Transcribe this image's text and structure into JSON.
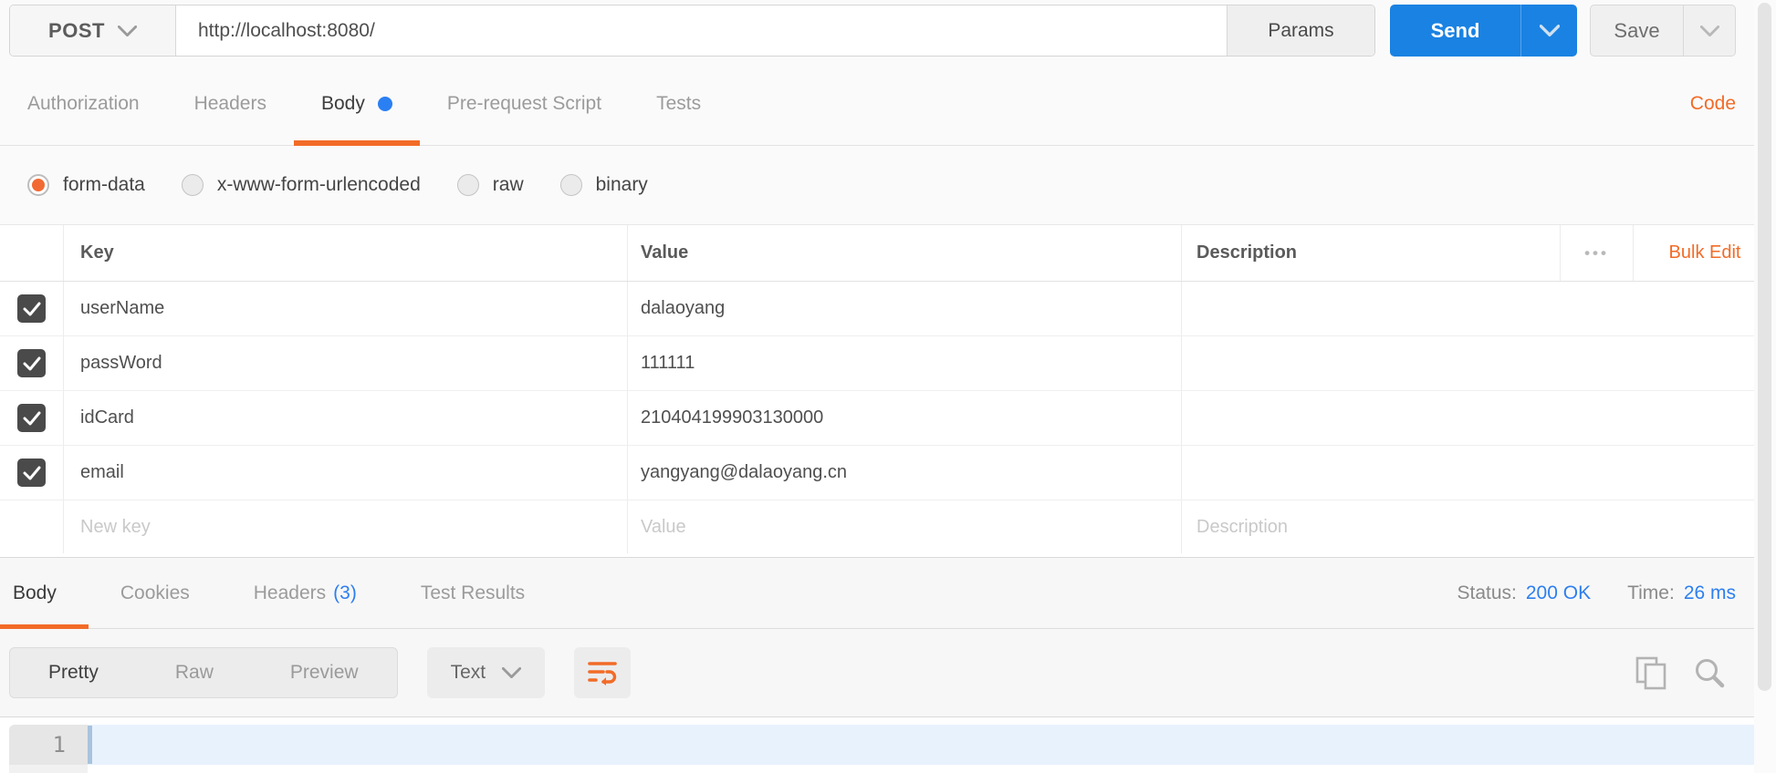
{
  "request_bar": {
    "method": "POST",
    "url": "http://localhost:8080/",
    "params_label": "Params",
    "send_label": "Send",
    "save_label": "Save"
  },
  "request_tabs": {
    "items": [
      {
        "label": "Authorization",
        "active": false
      },
      {
        "label": "Headers",
        "active": false
      },
      {
        "label": "Body",
        "active": true,
        "has_blue_dot": true
      },
      {
        "label": "Pre-request Script",
        "active": false
      },
      {
        "label": "Tests",
        "active": false
      }
    ],
    "code_link": "Code"
  },
  "body_type": {
    "options": [
      {
        "label": "form-data",
        "selected": true
      },
      {
        "label": "x-www-form-urlencoded",
        "selected": false
      },
      {
        "label": "raw",
        "selected": false
      },
      {
        "label": "binary",
        "selected": false
      }
    ]
  },
  "form_table": {
    "headers": {
      "key": "Key",
      "value": "Value",
      "description": "Description",
      "bulk_edit": "Bulk Edit",
      "menu": "•••"
    },
    "rows": [
      {
        "checked": true,
        "key": "userName",
        "value": "dalaoyang",
        "description": ""
      },
      {
        "checked": true,
        "key": "passWord",
        "value": "111111",
        "description": ""
      },
      {
        "checked": true,
        "key": "idCard",
        "value": "210404199903130000",
        "description": ""
      },
      {
        "checked": true,
        "key": "email",
        "value": "yangyang@dalaoyang.cn",
        "description": ""
      }
    ],
    "placeholder_row": {
      "key": "New key",
      "value": "Value",
      "description": "Description"
    }
  },
  "response": {
    "tabs": [
      {
        "label": "Body",
        "active": true
      },
      {
        "label": "Cookies",
        "active": false
      },
      {
        "label": "Headers",
        "count": "(3)",
        "active": false
      },
      {
        "label": "Test Results",
        "active": false
      }
    ],
    "status_label": "Status:",
    "status_value": "200 OK",
    "time_label": "Time:",
    "time_value": "26 ms",
    "view_modes": [
      {
        "label": "Pretty",
        "active": true
      },
      {
        "label": "Raw",
        "active": false
      },
      {
        "label": "Preview",
        "active": false
      }
    ],
    "format_selected": "Text",
    "editor": {
      "line_number": "1",
      "content": ""
    }
  },
  "icons": {
    "method_caret": "chevron-down",
    "send_caret": "chevron-down",
    "save_caret": "chevron-down",
    "format_caret": "chevron-down",
    "wrap": "word-wrap-arrow",
    "copy": "copy-pages",
    "search": "magnifier",
    "row_check": "checkmark",
    "header_menu": "ellipsis"
  },
  "colors": {
    "accent_orange": "#f26b27",
    "send_blue": "#1a82e2",
    "link_blue": "#2d7ff0",
    "checkbox_dark": "#4a4a4a",
    "radio_selected": "#f26a33",
    "active_line_blue": "#e8f2fd"
  }
}
